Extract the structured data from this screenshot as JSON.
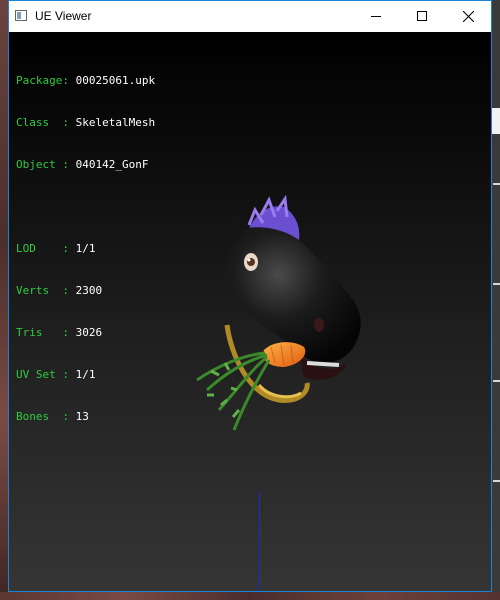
{
  "window": {
    "title": "UE Viewer"
  },
  "title_controls": {
    "minimize_icon": "minimize-icon",
    "maximize_icon": "maximize-icon",
    "close_icon": "close-icon"
  },
  "info": {
    "package_label": "Package",
    "package_value": "00025061.upk",
    "class_label": "Class  ",
    "class_value": "SkeletalMesh",
    "object_label": "Object ",
    "object_value": "040142_GonF",
    "lod_label": "LOD    ",
    "lod_value": "1/1",
    "verts_label": "Verts  ",
    "verts_value": "2300",
    "tris_label": "Tris   ",
    "tris_value": "3026",
    "uvset_label": "UV Set ",
    "uvset_value": "1/1",
    "bones_label": "Bones  ",
    "bones_value": "13"
  },
  "colors": {
    "label": "#2ecc40",
    "value": "#ffffff",
    "axis": "#1a2ad6",
    "accent_border": "#1883d7"
  }
}
